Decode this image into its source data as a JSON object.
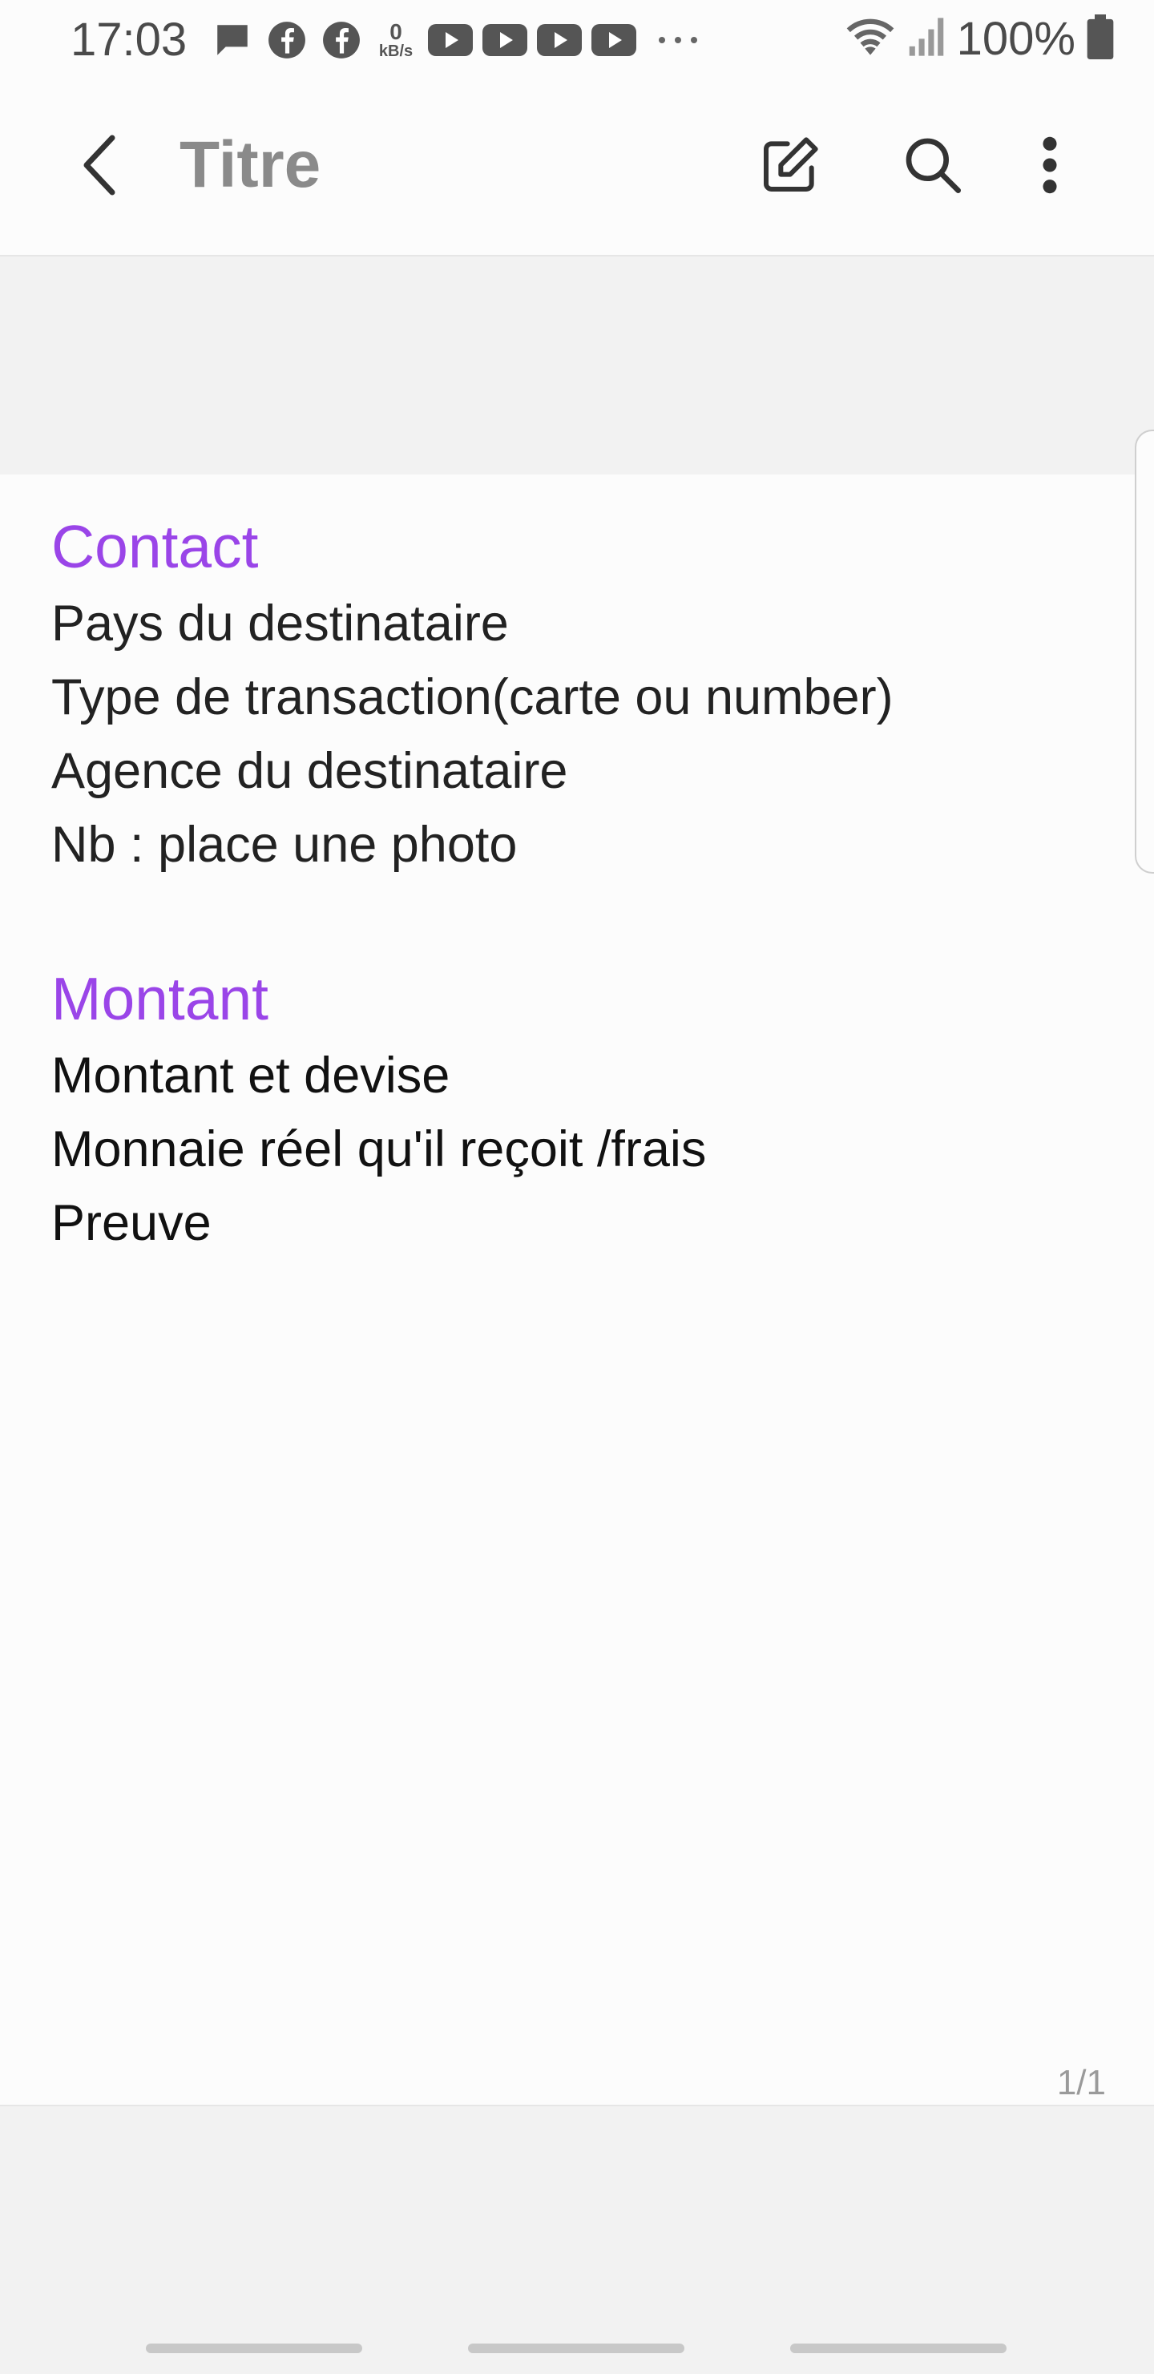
{
  "status_bar": {
    "time": "17:03",
    "battery": "100%",
    "network_speed_value": "0",
    "network_speed_unit": "kB/s",
    "icons": [
      "message-icon",
      "facebook-icon",
      "facebook-icon",
      "network-speed-icon",
      "youtube-icon",
      "youtube-icon",
      "youtube-icon",
      "youtube-icon",
      "more-dots-icon",
      "wifi-icon",
      "signal-icon",
      "battery-icon"
    ]
  },
  "app_bar": {
    "title": "Titre",
    "icons": [
      "back-icon",
      "edit-icon",
      "search-icon",
      "more-vert-icon"
    ]
  },
  "note": {
    "sections": [
      {
        "heading": "Contact",
        "lines": [
          "Pays du destinataire",
          "Type de transaction(carte ou number)",
          "Agence du destinataire",
          "Nb : place une photo"
        ]
      },
      {
        "heading": "Montant",
        "lines": [
          "Montant et devise",
          "Monnaie réel qu'il reçoit /frais",
          "Preuve"
        ]
      }
    ],
    "page_indicator": "1/1"
  },
  "colors": {
    "heading_accent": "#9a45e8",
    "text": "#222222",
    "background": "#fcfcfc",
    "panel_gray": "#f2f2f2"
  }
}
